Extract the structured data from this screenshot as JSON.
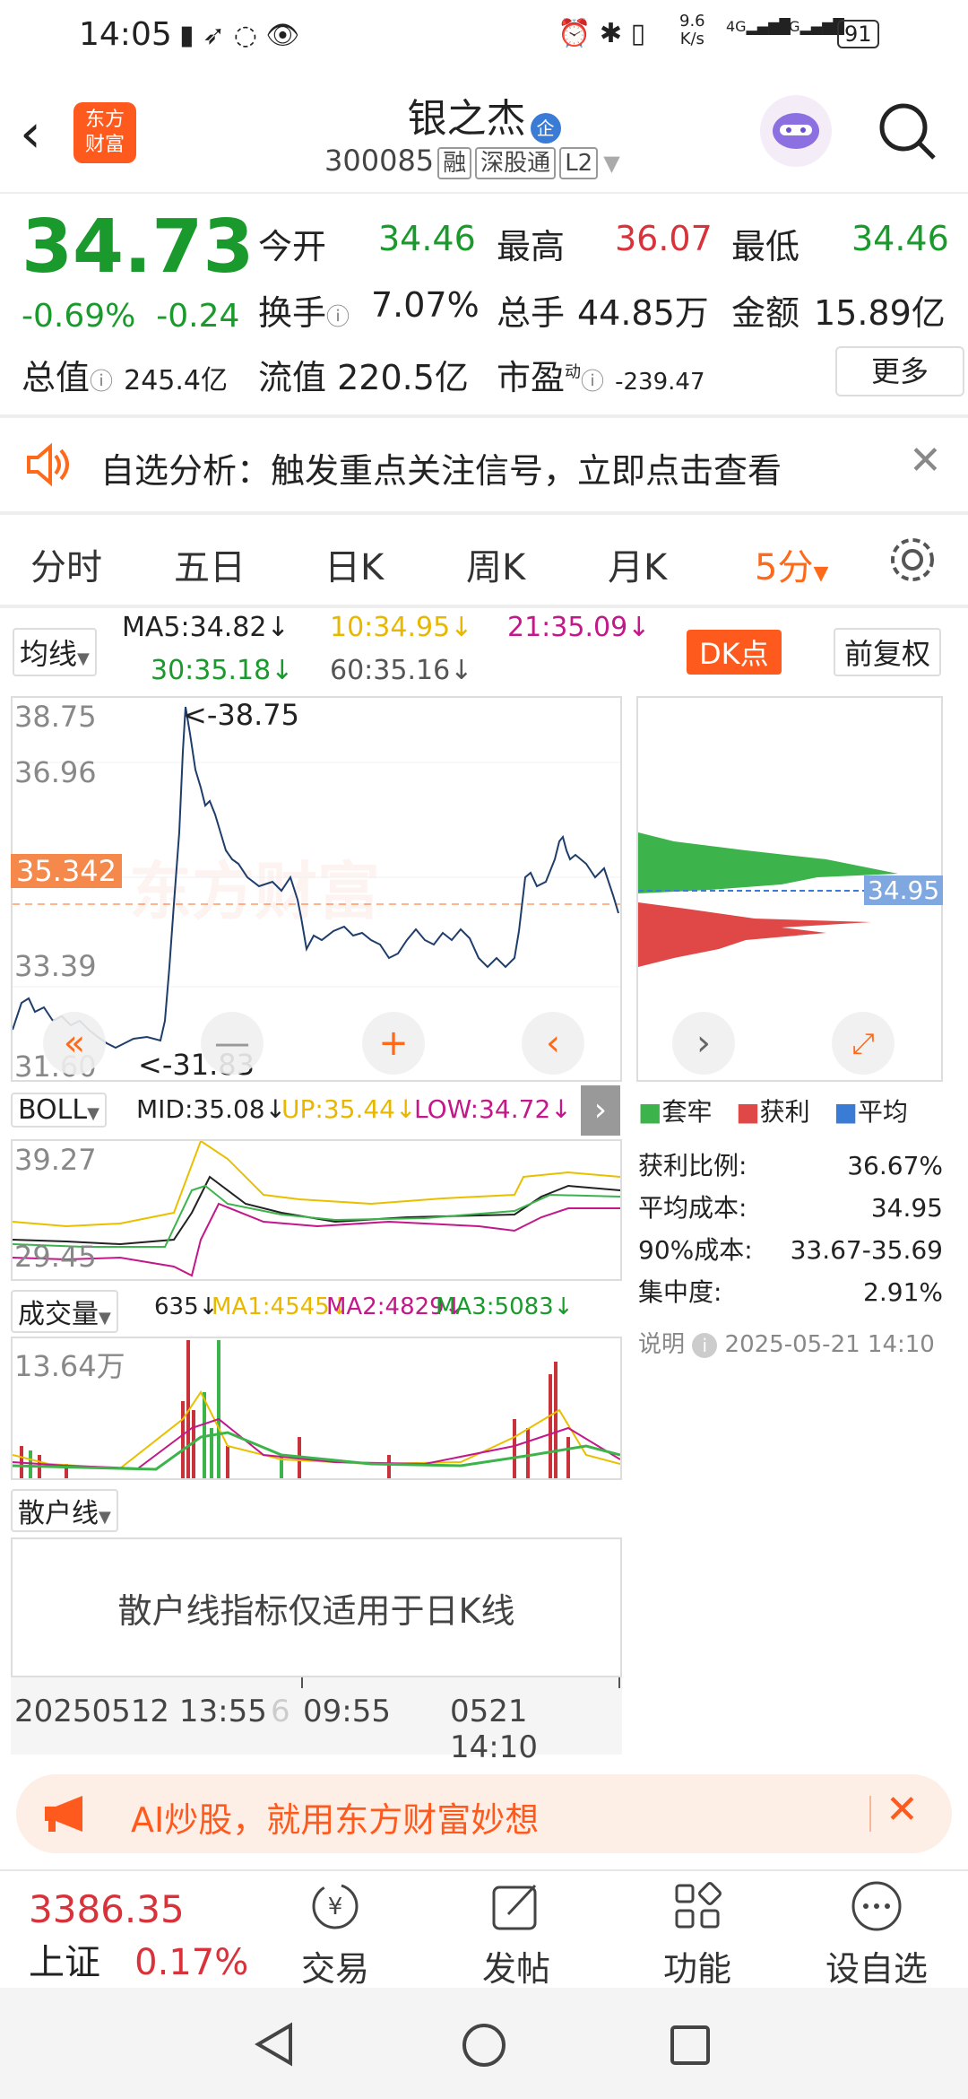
{
  "status": {
    "time": "14:05",
    "speed": "9.6\nK/s",
    "speed_top": "9.6",
    "speed_bottom": "K/s",
    "net1": "4G",
    "net2": "4G",
    "battery": "91"
  },
  "header": {
    "logo_top": "东方",
    "logo_bottom": "财富",
    "name": "银之杰",
    "badge": "企",
    "code": "300085",
    "tags": [
      "融",
      "深股通",
      "L2"
    ]
  },
  "quote": {
    "price": "34.73",
    "change_pct": "-0.69%",
    "change": "-0.24",
    "open_label": "今开",
    "open": "34.46",
    "high_label": "最高",
    "high": "36.07",
    "low_label": "最低",
    "low": "34.46",
    "turnover_label": "换手",
    "turnover": "7.07%",
    "volume_label": "总手",
    "volume": "44.85万",
    "amount_label": "金额",
    "amount": "15.89亿",
    "mcap_label": "总值",
    "mcap": "245.4亿",
    "float_label": "流值",
    "float": "220.5亿",
    "pe_label": "市盈",
    "pe_sup": "动",
    "pe": "-239.47",
    "more": "更多"
  },
  "notice": {
    "text": "自选分析：触发重点关注信号，立即点击查看"
  },
  "tabs": [
    "分时",
    "五日",
    "日K",
    "周K",
    "月K",
    "5分"
  ],
  "ma": {
    "selector": "均线",
    "ma5": "MA5:34.82↓",
    "ma10": "10:34.95↓",
    "ma21": "21:35.09↓",
    "ma30": "30:35.18↓",
    "ma60": "60:35.16↓",
    "dk": "DK点",
    "fq": "前复权"
  },
  "main_chart": {
    "y_labels": [
      "38.75",
      "36.96",
      "33.39",
      "31.60"
    ],
    "current_marker": "35.342",
    "max_label": "<-38.75",
    "min_label": "<-31.83",
    "watermark": "东方财富"
  },
  "chip": {
    "price_tag": "34.95",
    "legend": [
      "套牢",
      "获利",
      "平均"
    ],
    "rows": [
      {
        "k": "获利比例:",
        "v": "36.67%"
      },
      {
        "k": "平均成本:",
        "v": "34.95"
      },
      {
        "k": "90%成本:",
        "v": "33.67-35.69"
      },
      {
        "k": "集中度:",
        "v": "2.91%"
      }
    ],
    "note_label": "说明",
    "note_time": "2025-05-21 14:10"
  },
  "boll": {
    "selector": "BOLL",
    "mid": "MID:35.08↓",
    "up": "UP:35.44↓",
    "low": "LOW:34.72↓",
    "y_top": "39.27",
    "y_bottom": "29.45"
  },
  "vol": {
    "selector": "成交量",
    "v": "635↓",
    "ma1": "MA1:4545↓",
    "ma2": "MA2:4829↓",
    "ma3": "MA3:5083↓",
    "y_top": "13.64万"
  },
  "retail": {
    "selector": "散户线",
    "message": "散户线指标仅适用于日K线"
  },
  "time_axis": {
    "left": "20250512 13:55",
    "mid_prefix": "6",
    "mid": "09:55",
    "right": "0521 14:10"
  },
  "ad": {
    "text": "AI炒股，就用东方财富妙想"
  },
  "bottom": {
    "index_value": "3386.35",
    "index_name": "上证",
    "index_pct": "0.17%",
    "trade": "交易",
    "post": "发帖",
    "func": "功能",
    "watch": "设自选"
  },
  "colors": {
    "accent": "#ff6a1a",
    "up": "#d8323a",
    "down": "#1a9a2c"
  }
}
